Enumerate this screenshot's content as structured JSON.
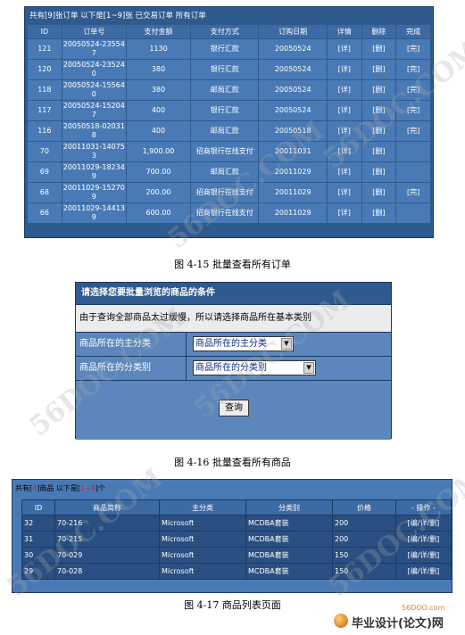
{
  "orders_panel": {
    "summary": "共有[9]张订单 以下是[1~9]张 已交易订单 所有订单",
    "columns": [
      "ID",
      "订单号",
      "支付金额",
      "支付方式",
      "订购日期",
      "详情",
      "删除",
      "完成"
    ],
    "rows": [
      {
        "id": "121",
        "order_no": "20050524-235547",
        "amount": "1130",
        "method": "银行汇款",
        "date": "20050524",
        "detail": "[详]",
        "delete": "[删]",
        "done": "[完]"
      },
      {
        "id": "120",
        "order_no": "20050524-235240",
        "amount": "380",
        "method": "银行汇款",
        "date": "20050524",
        "detail": "[详]",
        "delete": "[删]",
        "done": "[完]"
      },
      {
        "id": "118",
        "order_no": "20050524-155640",
        "amount": "380",
        "method": "邮局汇款",
        "date": "20050524",
        "detail": "[详]",
        "delete": "[删]",
        "done": "[完]"
      },
      {
        "id": "117",
        "order_no": "20050524-152047",
        "amount": "400",
        "method": "银行汇款",
        "date": "20050524",
        "detail": "[详]",
        "delete": "[删]",
        "done": "[完]"
      },
      {
        "id": "116",
        "order_no": "20050518-020318",
        "amount": "400",
        "method": "邮局汇款",
        "date": "20050518",
        "detail": "[详]",
        "delete": "[删]",
        "done": "[完]"
      },
      {
        "id": "70",
        "order_no": "20011031-140753",
        "amount": "1,900.00",
        "method": "招商银行在线支付",
        "date": "20011031",
        "detail": "[详]",
        "delete": "[删]",
        "done": ""
      },
      {
        "id": "69",
        "order_no": "20011029-182349",
        "amount": "700.00",
        "method": "邮局汇款",
        "date": "20011029",
        "detail": "[详]",
        "delete": "[删]",
        "done": ""
      },
      {
        "id": "68",
        "order_no": "20011029-152709",
        "amount": "200.00",
        "method": "招商银行在线支付",
        "date": "20011029",
        "detail": "[详]",
        "delete": "[删]",
        "done": "[完]"
      },
      {
        "id": "66",
        "order_no": "20011029-144139",
        "amount": "600.00",
        "method": "招商银行在线支付",
        "date": "20011029",
        "detail": "[详]",
        "delete": "[删]",
        "done": ""
      }
    ]
  },
  "captions": {
    "fig15": "图 4-15 批量查看所有订单",
    "fig16": "图 4-16  批量查看所有商品",
    "fig17": "图 4-17 商品列表页面"
  },
  "browse_panel": {
    "header": "请选择您要批量浏览的商品的条件",
    "note": "由于查询全部商品太过缓慢，所以请选择商品所在基本类别",
    "main_category_label": "商品所在的主分类",
    "main_category_value": "商品所在的主分类",
    "sub_category_label": "商品所在的分类别",
    "sub_category_value": "商品所在的分类别",
    "query_button": "查询"
  },
  "products_panel": {
    "summary_prefix": "共有[",
    "summary_count": "4",
    "summary_mid": "]商品 以下是[",
    "summary_range": "1~4",
    "summary_suffix": "]个",
    "columns": [
      "ID",
      "商品简称",
      "主分类",
      "分类别",
      "价格",
      "- 操作 -"
    ],
    "rows": [
      {
        "id": "32",
        "name": "70-216",
        "main": "Microsoft",
        "sub": "MCDBA套装",
        "price": "200",
        "ops": "[编/详/删]"
      },
      {
        "id": "31",
        "name": "70-215",
        "main": "Microsoft",
        "sub": "MCDBA套装",
        "price": "200",
        "ops": "[编/详/删]"
      },
      {
        "id": "30",
        "name": "70-029",
        "main": "Microsoft",
        "sub": "MCDBA套装",
        "price": "150",
        "ops": "[编/详/删]"
      },
      {
        "id": "29",
        "name": "70-028",
        "main": "Microsoft",
        "sub": "MCDBA套装",
        "price": "150",
        "ops": "[编/详/删]"
      }
    ]
  },
  "watermark_text": "56DOC.COM",
  "logo": {
    "site": "56DOO.com",
    "name": "毕业设计(论文)网"
  },
  "colors": {
    "panel_bg": "#2f5a8e",
    "cell_bg": "#4a7ab5",
    "highlight_red": "#d1202a"
  }
}
